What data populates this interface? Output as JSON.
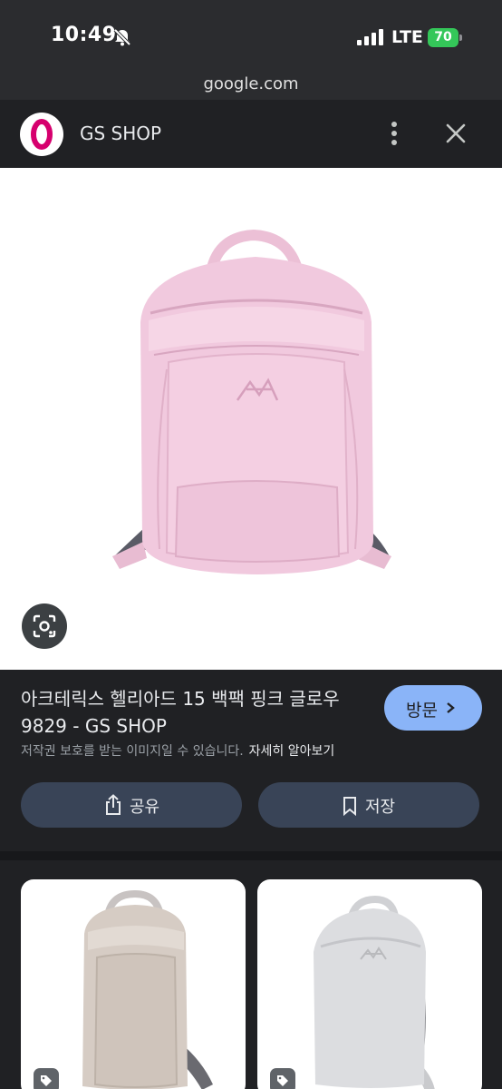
{
  "status_bar": {
    "time": "10:49",
    "network": "LTE",
    "battery": "70"
  },
  "browser": {
    "url": "google.com"
  },
  "header": {
    "site_name": "GS SHOP",
    "logo_letter": "O"
  },
  "product": {
    "title_line1": "아크테릭스 헬리아드 15 백팩 핑크 글로우",
    "title_line2": "9829 - GS SHOP",
    "visit_label": "방문",
    "copyright": "저작권 보호를 받는 이미지일 수 있습니다.",
    "learn_more": "자세히 알아보기",
    "share_label": "공유",
    "save_label": "저장"
  },
  "colors": {
    "accent": "#8ab4f8",
    "background": "#202124",
    "button_bg": "#394457",
    "battery": "#34c759",
    "brand": "#d6006e",
    "backpack_main": "#f1c9de"
  },
  "icons": [
    "bell-slash-icon",
    "signal-icon",
    "battery-icon",
    "more-vert-icon",
    "close-icon",
    "lens-icon",
    "share-icon",
    "bookmark-icon",
    "tag-icon"
  ]
}
